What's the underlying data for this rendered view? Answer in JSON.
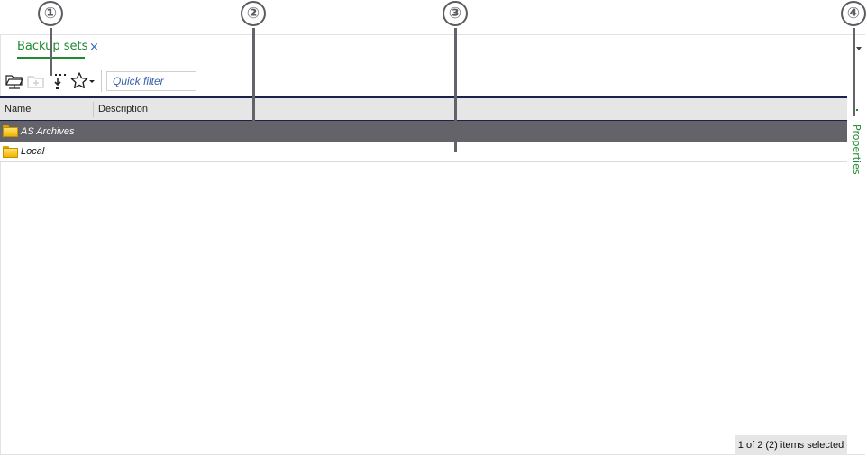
{
  "tab": {
    "label": "Backup sets",
    "close": "×"
  },
  "toolbar": {
    "buttons": [
      {
        "name": "open-network-folder",
        "icon": "network-folder-icon"
      },
      {
        "name": "new-folder",
        "icon": "add-folder-icon",
        "disabled": true
      },
      {
        "name": "move-down",
        "icon": "insert-arrow-icon"
      },
      {
        "name": "favorites",
        "icon": "star-icon",
        "has_dropdown": true
      }
    ],
    "quick_filter": {
      "placeholder": "Quick filter",
      "value": ""
    }
  },
  "grid": {
    "columns": [
      "Name",
      "Description"
    ],
    "rows": [
      {
        "name": "AS Archives",
        "description": "",
        "selected": true
      },
      {
        "name": "Local",
        "description": "",
        "selected": false
      }
    ]
  },
  "side_panel": {
    "label": "Properties"
  },
  "status": {
    "text": "1 of 2 (2) items selected"
  },
  "callouts": [
    "①",
    "②",
    "③",
    "④"
  ],
  "colors": {
    "accent": "#1e8b2e",
    "selected_row": "#636369",
    "header_border": "#1d1f4d",
    "callout": "#5b5b60"
  }
}
